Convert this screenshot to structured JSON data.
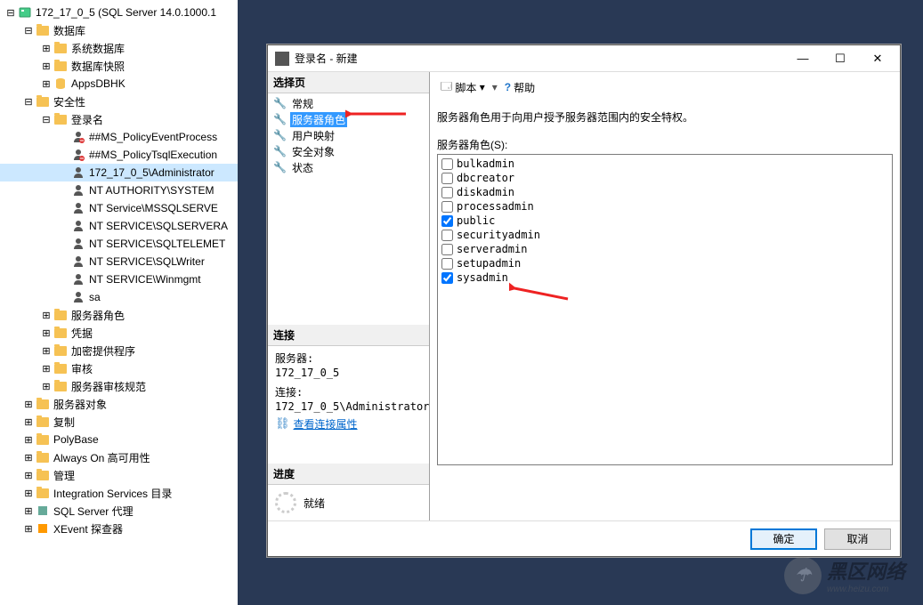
{
  "tree": {
    "root": "172_17_0_5 (SQL Server 14.0.1000.1",
    "databases": "数据库",
    "sys_db": "系统数据库",
    "snapshot": "数据库快照",
    "appsdb": "AppsDBHK",
    "security": "安全性",
    "logins": "登录名",
    "l_policy_event": "##MS_PolicyEventProcess",
    "l_policy_tsql": "##MS_PolicyTsqlExecution",
    "l_admin": "172_17_0_5\\Administrator",
    "l_ntauth": "NT AUTHORITY\\SYSTEM",
    "l_mssql": "NT Service\\MSSQLSERVE",
    "l_sqlagent": "NT SERVICE\\SQLSERVERA",
    "l_sqltelem": "NT SERVICE\\SQLTELEMET",
    "l_sqlwriter": "NT SERVICE\\SQLWriter",
    "l_winmgmt": "NT SERVICE\\Winmgmt",
    "l_sa": "sa",
    "server_roles": "服务器角色",
    "credentials": "凭据",
    "crypto": "加密提供程序",
    "audit": "审核",
    "audit_spec": "服务器审核规范",
    "server_objects": "服务器对象",
    "replication": "复制",
    "polybase": "PolyBase",
    "alwayson": "Always On 高可用性",
    "management": "管理",
    "integration": "Integration Services 目录",
    "sqlagent": "SQL Server 代理",
    "xevent": "XEvent 探查器"
  },
  "dialog": {
    "title": "登录名 - 新建",
    "select_page": "选择页",
    "pages": {
      "general": "常规",
      "server_roles": "服务器角色",
      "user_map": "用户映射",
      "securables": "安全对象",
      "status": "状态"
    },
    "connection_hdr": "连接",
    "server_label": "服务器:",
    "server_value": "172_17_0_5",
    "conn_label": "连接:",
    "conn_value": "172_17_0_5\\Administrator",
    "view_conn": "查看连接属性",
    "progress_hdr": "进度",
    "progress_ready": "就绪",
    "script_btn": "脚本",
    "help_btn": "帮助",
    "desc": "服务器角色用于向用户授予服务器范围内的安全特权。",
    "roles_label": "服务器角色(S):",
    "roles": [
      {
        "name": "bulkadmin",
        "checked": false
      },
      {
        "name": "dbcreator",
        "checked": false
      },
      {
        "name": "diskadmin",
        "checked": false
      },
      {
        "name": "processadmin",
        "checked": false
      },
      {
        "name": "public",
        "checked": true
      },
      {
        "name": "securityadmin",
        "checked": false
      },
      {
        "name": "serveradmin",
        "checked": false
      },
      {
        "name": "setupadmin",
        "checked": false
      },
      {
        "name": "sysadmin",
        "checked": true
      }
    ],
    "ok": "确定",
    "cancel": "取消"
  },
  "watermark": {
    "text": "黑区网络",
    "sub": "www.heizu.com"
  }
}
